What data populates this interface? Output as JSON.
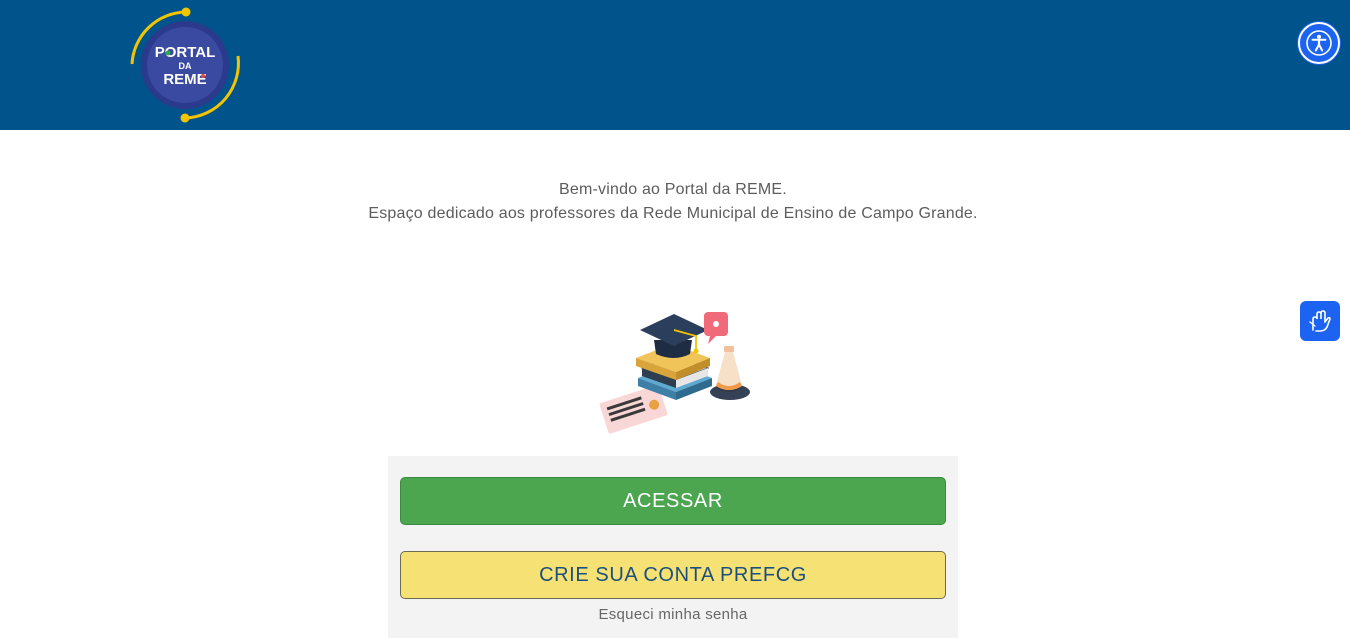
{
  "header": {
    "logo": {
      "line1": "PORTAL",
      "line2": "DA",
      "line3": "REME",
      "ring_color": "#2b3a8c",
      "orbit_color": "#f2c500"
    },
    "accessibility_icon": "accessibility-icon",
    "background": "#00548b"
  },
  "welcome": {
    "line1": "Bem-vindo ao Portal da REME.",
    "line2": "Espaço dedicado aos professores da Rede Municipal de Ensino de Campo Grande."
  },
  "illustration": {
    "icon": "graduation-illustration"
  },
  "libras": {
    "icon": "sign-language-icon"
  },
  "login_panel": {
    "access_label": "ACESSAR",
    "create_label": "CRIE SUA CONTA PREFCG",
    "forgot_label": "Esqueci minha senha",
    "access_color": "#4ca650",
    "create_color": "#f6e274"
  }
}
